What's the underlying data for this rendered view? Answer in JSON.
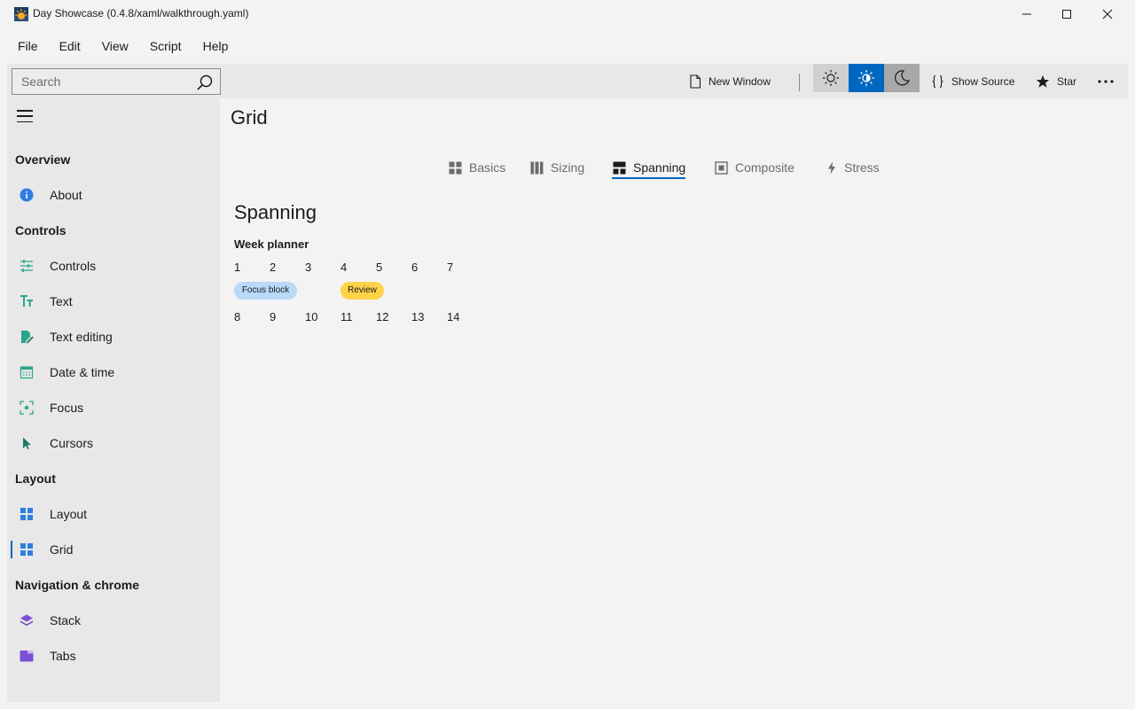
{
  "window": {
    "title": "Day Showcase (0.4.8/xaml/walkthrough.yaml)"
  },
  "menu": [
    "File",
    "Edit",
    "View",
    "Script",
    "Help"
  ],
  "toolbar": {
    "search_placeholder": "Search",
    "new_window": "New Window",
    "show_source": "Show Source",
    "star": "Star",
    "theme_selected": "high-contrast-icon"
  },
  "sidebar": {
    "sections": [
      {
        "header": "Overview",
        "items": [
          {
            "label": "About",
            "icon": "info-icon"
          }
        ]
      },
      {
        "header": "Controls",
        "items": [
          {
            "label": "Controls",
            "icon": "sliders-icon"
          },
          {
            "label": "Text",
            "icon": "text-icon"
          },
          {
            "label": "Text editing",
            "icon": "edit-icon"
          },
          {
            "label": "Date & time",
            "icon": "calendar-icon"
          },
          {
            "label": "Focus",
            "icon": "focus-icon"
          },
          {
            "label": "Cursors",
            "icon": "cursor-icon"
          }
        ]
      },
      {
        "header": "Layout",
        "items": [
          {
            "label": "Layout",
            "icon": "layout-grid-icon"
          },
          {
            "label": "Grid",
            "icon": "grid-icon",
            "selected": true
          }
        ]
      },
      {
        "header": "Navigation & chrome",
        "items": [
          {
            "label": "Stack",
            "icon": "stack-icon"
          },
          {
            "label": "Tabs",
            "icon": "tabs-icon"
          }
        ]
      }
    ]
  },
  "page": {
    "title": "Grid",
    "tabs": [
      {
        "label": "Basics",
        "icon": "grid-icon"
      },
      {
        "label": "Sizing",
        "icon": "columns-icon"
      },
      {
        "label": "Spanning",
        "icon": "spanning-icon",
        "active": true
      },
      {
        "label": "Composite",
        "icon": "composite-icon"
      },
      {
        "label": "Stress",
        "icon": "lightning-icon"
      }
    ],
    "section_title": "Spanning",
    "planner": {
      "title": "Week planner",
      "week1": [
        "1",
        "2",
        "3",
        "4",
        "5",
        "6",
        "7"
      ],
      "week2": [
        "8",
        "9",
        "10",
        "11",
        "12",
        "13",
        "14"
      ],
      "events": [
        {
          "label": "Focus block",
          "color": "#b8d9f7"
        },
        {
          "label": "Review",
          "color": "#ffd24a"
        }
      ]
    }
  },
  "colors": {
    "accent": "#0067c0",
    "background": "#f3f3f3",
    "pane": "#e8e8e8"
  }
}
